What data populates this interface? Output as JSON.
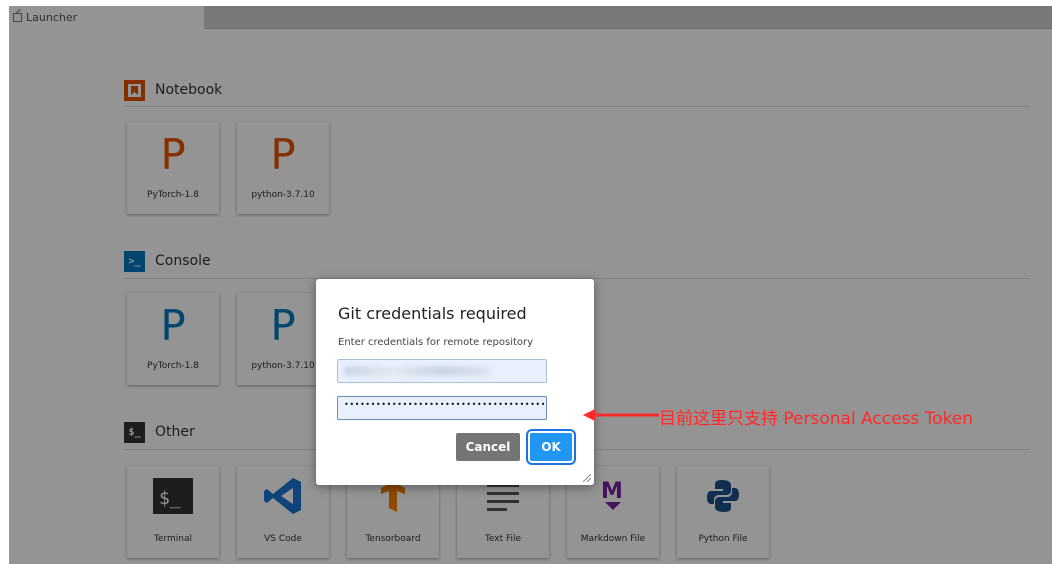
{
  "tab": {
    "label": "Launcher"
  },
  "sections": {
    "notebook": {
      "title": "Notebook",
      "icon": "notebook-icon",
      "color": "#e65100"
    },
    "console": {
      "title": "Console",
      "icon": "console-icon",
      "color": "#0277bd"
    },
    "other": {
      "title": "Other",
      "icon": "terminal-icon",
      "color": "#333333"
    }
  },
  "notebook_cards": [
    {
      "glyph": "P",
      "label": "PyTorch-1.8"
    },
    {
      "glyph": "P",
      "label": "python-3.7.10"
    }
  ],
  "console_cards": [
    {
      "glyph": "P",
      "label": "PyTorch-1.8"
    },
    {
      "glyph": "P",
      "label": "python-3.7.10"
    }
  ],
  "other_cards": [
    {
      "icon": "terminal-icon",
      "label": "Terminal"
    },
    {
      "icon": "vscode-icon",
      "label": "VS Code"
    },
    {
      "icon": "tensorboard-icon",
      "label": "Tensorboard"
    },
    {
      "icon": "text-file-icon",
      "label": "Text File"
    },
    {
      "icon": "markdown-icon",
      "label": "Markdown File"
    },
    {
      "icon": "python-icon",
      "label": "Python File"
    }
  ],
  "dialog": {
    "title": "Git credentials required",
    "subtitle": "Enter credentials for remote repository",
    "password_mask": "••••••••••••••••••••••••••••••••••••••",
    "cancel_label": "Cancel",
    "ok_label": "OK"
  },
  "annotation": {
    "text": "目前这里只支持 Personal Access Token",
    "color": "#ff2a2a"
  }
}
